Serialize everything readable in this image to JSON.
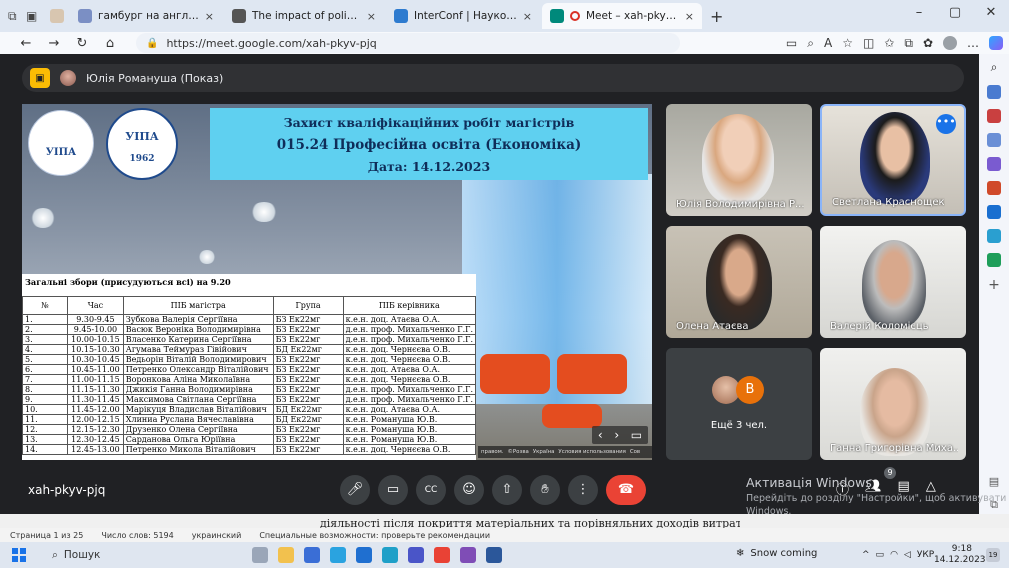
{
  "browser": {
    "tabs": [
      {
        "title": "гамбург на английском - Поиск",
        "active": false,
        "color": "#7b8fc4"
      },
      {
        "title": "The impact of political stability o",
        "active": false,
        "color": "#555555"
      },
      {
        "title": "InterConf | Наукова конференці",
        "active": false,
        "color": "#2e7bcf"
      },
      {
        "title": "Meet – xah-pkyv-pjq",
        "active": true,
        "color": "#00897b"
      }
    ],
    "new_tab": "+",
    "url": "https://meet.google.com/xah-pkyv-pjq"
  },
  "meet": {
    "presenter_label": "Юлія Романуша (Показ)",
    "meeting_code": "xah-pkyv-pjq",
    "slide": {
      "logo1_text": "УІПА",
      "logo2_text": "УІПА",
      "logo2_year": "1962",
      "title_line1": "Захист кваліфікаційних робіт магістрів",
      "title_line2": "015.24 Професійна освіта (Економіка)",
      "title_line3": "Дата: 14.12.2023",
      "table_caption": "Загальні збори (присудуються всі) на 9.20",
      "headers": [
        "№",
        "Час",
        "ПІБ магістра",
        "Група",
        "ПІБ керівника"
      ],
      "rows": [
        [
          "1.",
          "9.30-9.45",
          "Зубкова Валерія Сергіївна",
          "БЗ Ек22мг",
          "к.е.н. доц. Атаєва О.А."
        ],
        [
          "2.",
          "9.45-10.00",
          "Васюк Вероніка Володимирівна",
          "БЗ Ек22мг",
          "д.е.н. проф. Михальченко Г.Г."
        ],
        [
          "3.",
          "10.00-10.15",
          "Власенко Катерина Сергіївна",
          "БЗ Ек22мг",
          "д.е.н. проф. Михальченко Г.Г."
        ],
        [
          "4.",
          "10.15-10.30",
          "Агумава Теймураз Гівійович",
          "БД Ек22мг",
          "к.е.н. доц. Чернєєва О.В."
        ],
        [
          "5.",
          "10.30-10.45",
          "Ведьорін Віталій Володимирович",
          "БЗ Ек22мг",
          "к.е.н. доц. Чернєєва О.В."
        ],
        [
          "6.",
          "10.45-11.00",
          "Петренко Олександр Віталійович",
          "БЗ Ек22мг",
          "к.е.н. доц. Атаєва О.А."
        ],
        [
          "7.",
          "11.00-11.15",
          "Воронкова Аліна Миколаївна",
          "БЗ Ек22мг",
          "к.е.н. доц. Чернєєва О.В."
        ],
        [
          "8.",
          "11.15-11.30",
          "Джикія Ганна Володимирівна",
          "БЗ Ек22мг",
          "д.е.н. проф. Михальченко Г.Г."
        ],
        [
          "9.",
          "11.30-11.45",
          "Максимова Світлана Сергіївна",
          "БЗ Ек22мг",
          "д.е.н. проф. Михальченко Г.Г."
        ],
        [
          "10.",
          "11.45-12.00",
          "Марікуця Владислав Віталійович",
          "БД Ек22мг",
          "к.е.н. доц. Атаєва О.А."
        ],
        [
          "11.",
          "12.00-12.15",
          "Хлиниа Руслана Вячеславівна",
          "БД Ек22мг",
          "к.е.н. Романуша Ю.В."
        ],
        [
          "12.",
          "12.15-12.30",
          "Друзенко Олена Сергіївна",
          "БЗ Ек22мг",
          "к.е.н. Романуша Ю.В."
        ],
        [
          "13.",
          "12.30-12.45",
          "Сарданова Ольга Юріївна",
          "БЗ Ек22мг",
          "к.е.н. Романуша Ю.В."
        ],
        [
          "14.",
          "12.45-13.00",
          "Петренко Микола Віталійович",
          "БЗ Ек22мг",
          "к.е.н. доц. Чернєєва О.В."
        ]
      ],
      "footer_items": [
        "правом.",
        "©Розва",
        "Україна",
        "Условия использования",
        "Сов"
      ],
      "nav_prev": "‹",
      "nav_next": "›"
    },
    "participants": [
      {
        "name": "Юлія Володимирівна Р...",
        "selected": false
      },
      {
        "name": "Светлана Краснощек",
        "selected": true,
        "more": "•••"
      },
      {
        "name": "Олена Атаєва",
        "selected": false
      },
      {
        "name": "Валерій Коломієць",
        "selected": false
      },
      {
        "name": "Ганна Григорівна Миха...",
        "selected": false
      }
    ],
    "others": {
      "initial": "В",
      "label": "Ещё 3 чел."
    },
    "people_count": "9"
  },
  "activation": {
    "title": "Активація Windows",
    "line1": "Перейдіть до розділу \"Настройки\", щоб активувати",
    "line2": "Windows."
  },
  "word": {
    "body_text": "діяльності після покриття матеріальних та порівняльних доходів витрат.",
    "status": [
      "Страница 1 из 25",
      "Число слов: 5194",
      "украинский",
      "Специальные возможности: проверьте рекомендации"
    ]
  },
  "taskbar": {
    "search": "Пошук",
    "weather": "Snow coming",
    "lang": "УКР",
    "time": "9:18",
    "date": "14.12.2023",
    "notif": "19"
  }
}
